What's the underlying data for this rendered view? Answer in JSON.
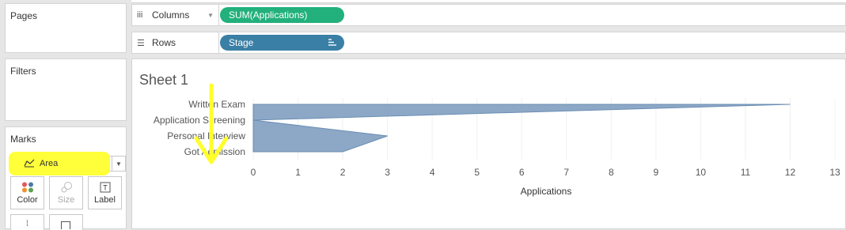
{
  "pages": {
    "title": "Pages"
  },
  "filters": {
    "title": "Filters"
  },
  "marks": {
    "title": "Marks",
    "mark_type": "Area",
    "buttons": [
      {
        "label": "Color",
        "icon": "color-dots-icon"
      },
      {
        "label": "Size",
        "icon": "size-icon"
      },
      {
        "label": "Label",
        "icon": "label-T-icon"
      }
    ]
  },
  "columns_shelf": {
    "label": "Columns",
    "pill": "SUM(Applications)"
  },
  "rows_shelf": {
    "label": "Rows",
    "pill": "Stage"
  },
  "sheet": {
    "title": "Sheet 1"
  },
  "colors": {
    "area": "#7f9fc0",
    "columns_pill": "#22b07c",
    "rows_pill": "#3a7fa5",
    "highlight": "#ffff3a"
  },
  "chart_data": {
    "type": "area",
    "orientation": "horizontal",
    "categories": [
      "Written Exam",
      "Application Screening",
      "Personal Interview",
      "Got Admission"
    ],
    "values": [
      12,
      0,
      3,
      2
    ],
    "xlabel": "Applications",
    "x_ticks": [
      0,
      1,
      2,
      3,
      4,
      5,
      6,
      7,
      8,
      9,
      10,
      11,
      12,
      13
    ],
    "xlim": [
      0,
      13
    ]
  }
}
